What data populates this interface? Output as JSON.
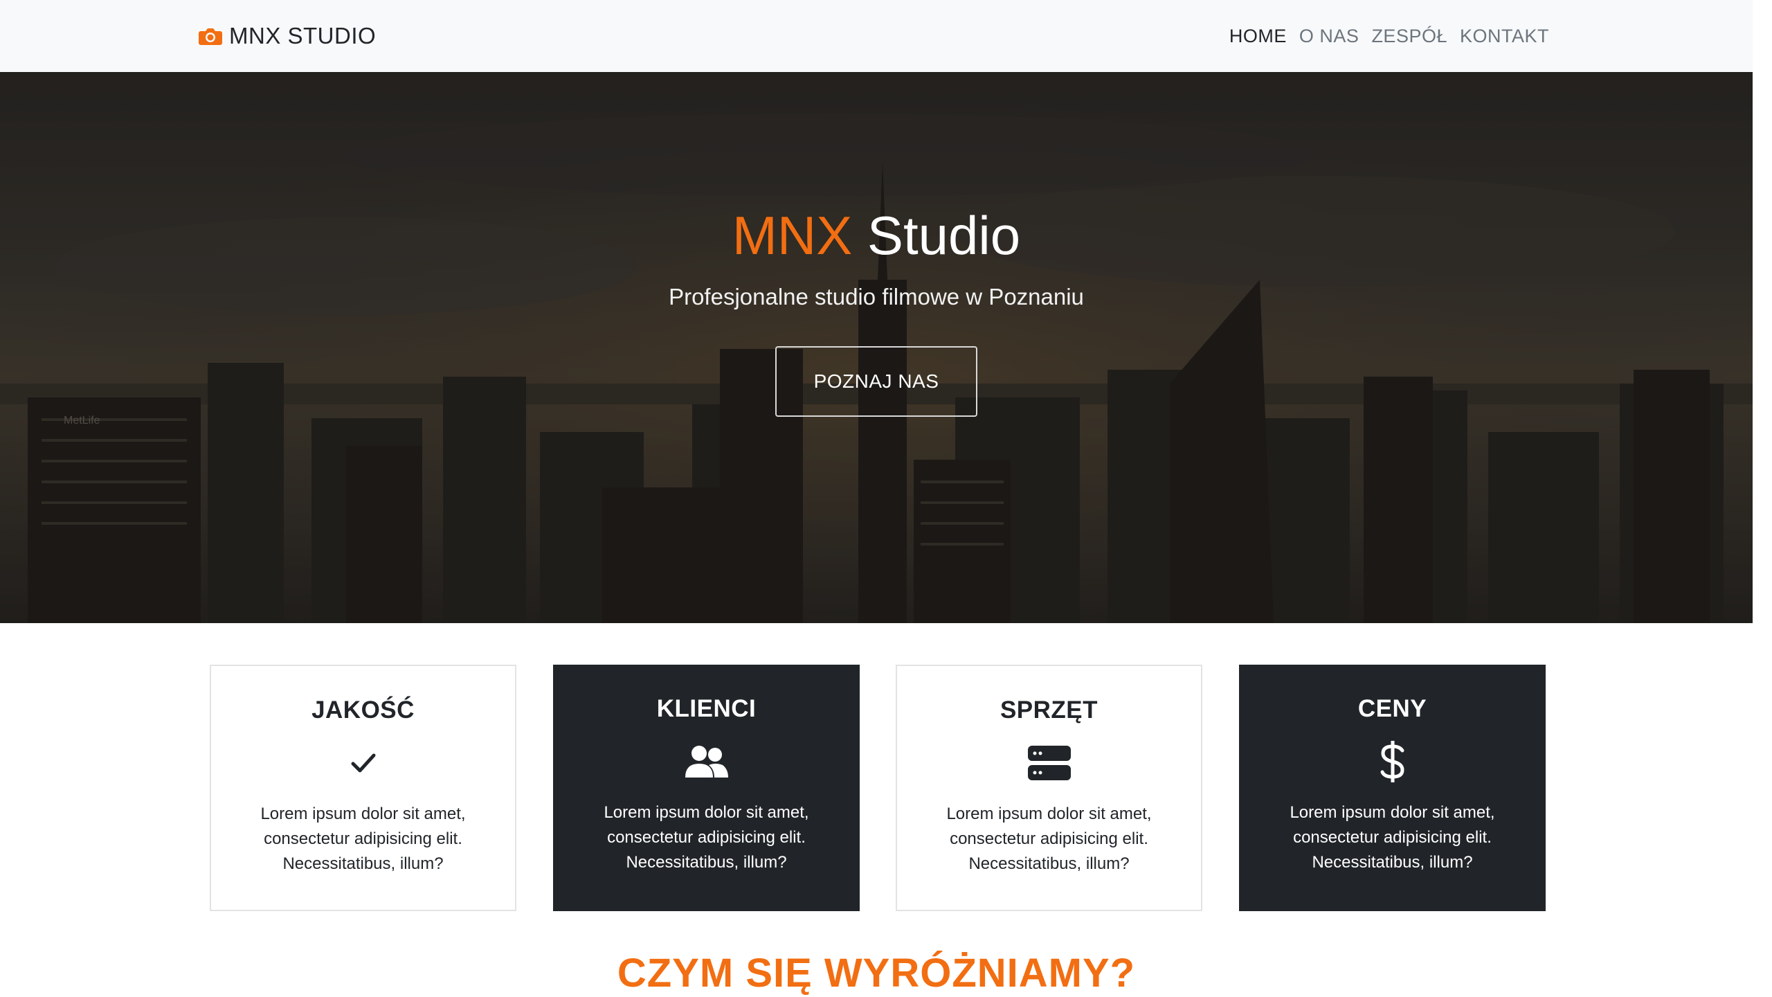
{
  "navbar": {
    "brand": "MNX STUDIO",
    "links": [
      {
        "label": "HOME",
        "active": true
      },
      {
        "label": "O NAS",
        "active": false
      },
      {
        "label": "ZESPÓŁ",
        "active": false
      },
      {
        "label": "KONTAKT",
        "active": false
      }
    ]
  },
  "hero": {
    "title_accent": "MNX",
    "title_rest": " Studio",
    "subtitle": "Profesjonalne studio filmowe w Poznaniu",
    "button": "POZNAJ NAS",
    "building_sign": "MetLife"
  },
  "features": [
    {
      "title": "JAKOŚĆ",
      "icon": "check-icon",
      "text": "Lorem ipsum dolor sit amet, consectetur adipisicing elit. Necessitatibus, illum?"
    },
    {
      "title": "KLIENCI",
      "icon": "users-icon",
      "text": "Lorem ipsum dolor sit amet, consectetur adipisicing elit. Necessitatibus, illum?"
    },
    {
      "title": "SPRZĘT",
      "icon": "server-icon",
      "text": "Lorem ipsum dolor sit amet, consectetur adipisicing elit. Necessitatibus, illum?"
    },
    {
      "title": "CENY",
      "icon": "dollar-icon",
      "text": "Lorem ipsum dolor sit amet, consectetur adipisicing elit. Necessitatibus, illum?"
    }
  ],
  "section": {
    "title": "CZYM SIĘ WYRÓŻNIAMY?"
  },
  "colors": {
    "accent": "#f26e12",
    "dark": "#212529",
    "navbar_bg": "#f8f9fa"
  }
}
